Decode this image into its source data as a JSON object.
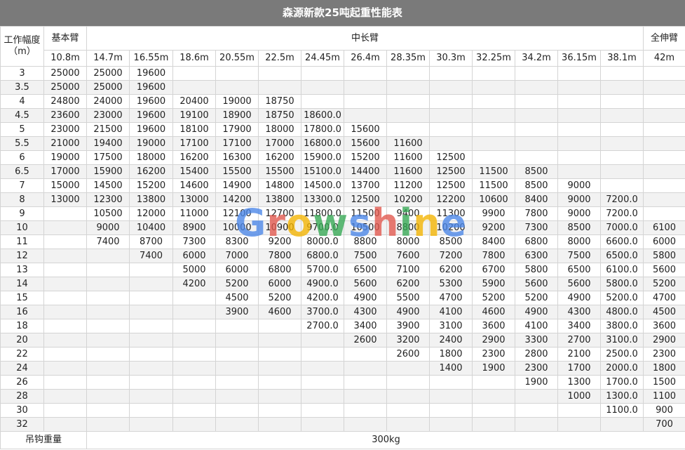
{
  "title": "森源新款25吨起重性能表",
  "headers": {
    "radius_label_line1": "工作幅度",
    "radius_label_line2": "（m）",
    "basic_boom": "基本臂",
    "mid_boom": "中长臂",
    "full_boom": "全伸臂"
  },
  "boom_lengths": [
    "10.8m",
    "14.7m",
    "16.55m",
    "18.6m",
    "20.55m",
    "22.5m",
    "24.45m",
    "26.4m",
    "28.35m",
    "30.3m",
    "32.25m",
    "34.2m",
    "36.15m",
    "38.1m",
    "42m"
  ],
  "rows": [
    {
      "r": "3",
      "v": [
        "25000",
        "25000",
        "19600",
        "",
        "",
        "",
        "",
        "",
        "",
        "",
        "",
        "",
        "",
        "",
        ""
      ]
    },
    {
      "r": "3.5",
      "v": [
        "25000",
        "25000",
        "19600",
        "",
        "",
        "",
        "",
        "",
        "",
        "",
        "",
        "",
        "",
        "",
        ""
      ]
    },
    {
      "r": "4",
      "v": [
        "24800",
        "24000",
        "19600",
        "20400",
        "19000",
        "18750",
        "",
        "",
        "",
        "",
        "",
        "",
        "",
        "",
        ""
      ]
    },
    {
      "r": "4.5",
      "v": [
        "23600",
        "23000",
        "19600",
        "19100",
        "18900",
        "18750",
        "18600.0",
        "",
        "",
        "",
        "",
        "",
        "",
        "",
        ""
      ]
    },
    {
      "r": "5",
      "v": [
        "23000",
        "21500",
        "19600",
        "18100",
        "17900",
        "18000",
        "17800.0",
        "15600",
        "",
        "",
        "",
        "",
        "",
        "",
        ""
      ]
    },
    {
      "r": "5.5",
      "v": [
        "21000",
        "19400",
        "19000",
        "17100",
        "17100",
        "17000",
        "16800.0",
        "15600",
        "11600",
        "",
        "",
        "",
        "",
        "",
        ""
      ]
    },
    {
      "r": "6",
      "v": [
        "19000",
        "17500",
        "18000",
        "16200",
        "16300",
        "16200",
        "15900.0",
        "15200",
        "11600",
        "12500",
        "",
        "",
        "",
        "",
        ""
      ]
    },
    {
      "r": "6.5",
      "v": [
        "17000",
        "15900",
        "16200",
        "15400",
        "15500",
        "15500",
        "15100.0",
        "14400",
        "11600",
        "12500",
        "11500",
        "8500",
        "",
        "",
        ""
      ]
    },
    {
      "r": "7",
      "v": [
        "15000",
        "14500",
        "15200",
        "14600",
        "14900",
        "14800",
        "14500.0",
        "13700",
        "11200",
        "12500",
        "11500",
        "8500",
        "9000",
        "",
        ""
      ]
    },
    {
      "r": "8",
      "v": [
        "13000",
        "12300",
        "13800",
        "13000",
        "14200",
        "13800",
        "13300.0",
        "12500",
        "10200",
        "12200",
        "10600",
        "8400",
        "9000",
        "7200.0",
        ""
      ]
    },
    {
      "r": "9",
      "v": [
        "",
        "10500",
        "12000",
        "11000",
        "12100",
        "12700",
        "11800.0",
        "11500",
        "9400",
        "11300",
        "9900",
        "7800",
        "9000",
        "7200.0",
        ""
      ]
    },
    {
      "r": "10",
      "v": [
        "",
        "9000",
        "10400",
        "8900",
        "10000",
        "10900",
        "9700.0",
        "10500",
        "8800",
        "10200",
        "9200",
        "7300",
        "8500",
        "7000.0",
        "6100"
      ]
    },
    {
      "r": "11",
      "v": [
        "",
        "7400",
        "8700",
        "7300",
        "8300",
        "9200",
        "8000.0",
        "8800",
        "8000",
        "8500",
        "8400",
        "6800",
        "8000",
        "6600.0",
        "6000"
      ]
    },
    {
      "r": "12",
      "v": [
        "",
        "",
        "7400",
        "6000",
        "7000",
        "7800",
        "6800.0",
        "7500",
        "7600",
        "7200",
        "7800",
        "6300",
        "7500",
        "6500.0",
        "5800"
      ]
    },
    {
      "r": "13",
      "v": [
        "",
        "",
        "",
        "5000",
        "6000",
        "6800",
        "5700.0",
        "6500",
        "7100",
        "6200",
        "6700",
        "5800",
        "6500",
        "6100.0",
        "5600"
      ]
    },
    {
      "r": "14",
      "v": [
        "",
        "",
        "",
        "4200",
        "5200",
        "6000",
        "4900.0",
        "5600",
        "6200",
        "5300",
        "5900",
        "5600",
        "5600",
        "5800.0",
        "5200"
      ]
    },
    {
      "r": "15",
      "v": [
        "",
        "",
        "",
        "",
        "4500",
        "5200",
        "4200.0",
        "4900",
        "5500",
        "4700",
        "5200",
        "5200",
        "4900",
        "5200.0",
        "4700"
      ]
    },
    {
      "r": "16",
      "v": [
        "",
        "",
        "",
        "",
        "3900",
        "4600",
        "3700.0",
        "4300",
        "4900",
        "4100",
        "4600",
        "4900",
        "4300",
        "4800.0",
        "4500"
      ]
    },
    {
      "r": "18",
      "v": [
        "",
        "",
        "",
        "",
        "",
        "",
        "2700.0",
        "3400",
        "3900",
        "3100",
        "3600",
        "4100",
        "3400",
        "3800.0",
        "3600"
      ]
    },
    {
      "r": "20",
      "v": [
        "",
        "",
        "",
        "",
        "",
        "",
        "",
        "2600",
        "3200",
        "2400",
        "2900",
        "3300",
        "2700",
        "3100.0",
        "2900"
      ]
    },
    {
      "r": "22",
      "v": [
        "",
        "",
        "",
        "",
        "",
        "",
        "",
        "",
        "2600",
        "1800",
        "2300",
        "2800",
        "2100",
        "2500.0",
        "2300"
      ]
    },
    {
      "r": "24",
      "v": [
        "",
        "",
        "",
        "",
        "",
        "",
        "",
        "",
        "",
        "1400",
        "1900",
        "2300",
        "1700",
        "2000.0",
        "1800"
      ]
    },
    {
      "r": "26",
      "v": [
        "",
        "",
        "",
        "",
        "",
        "",
        "",
        "",
        "",
        "",
        "",
        "1900",
        "1300",
        "1700.0",
        "1500"
      ]
    },
    {
      "r": "28",
      "v": [
        "",
        "",
        "",
        "",
        "",
        "",
        "",
        "",
        "",
        "",
        "",
        "",
        "1000",
        "1300.0",
        "1100"
      ]
    },
    {
      "r": "30",
      "v": [
        "",
        "",
        "",
        "",
        "",
        "",
        "",
        "",
        "",
        "",
        "",
        "",
        "",
        "1100.0",
        "900"
      ]
    },
    {
      "r": "32",
      "v": [
        "",
        "",
        "",
        "",
        "",
        "",
        "",
        "",
        "",
        "",
        "",
        "",
        "",
        "",
        "700"
      ]
    }
  ],
  "footer": {
    "hook_weight_label": "吊钩重量",
    "hook_weight_value": "300kg"
  },
  "watermark": {
    "letters": [
      "G",
      "r",
      "o",
      "w",
      "s",
      "h",
      "i",
      "n",
      "e"
    ]
  }
}
